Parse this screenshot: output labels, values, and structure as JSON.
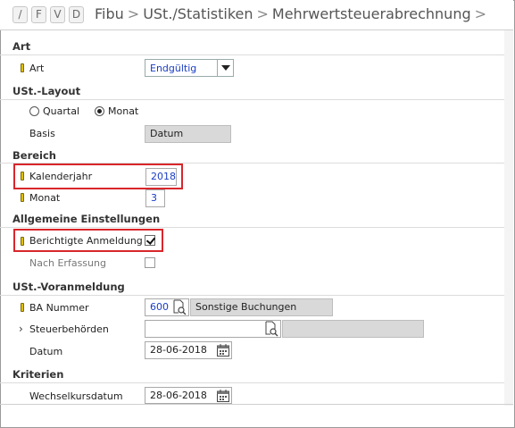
{
  "header": {
    "buttons": [
      "/",
      "F",
      "V",
      "D"
    ],
    "breadcrumb": [
      "Fibu",
      "USt./Statistiken",
      "Mehrwertsteuerabrechnung"
    ],
    "separator": ">"
  },
  "sections": {
    "art": "Art",
    "layout": "USt.-Layout",
    "bereich": "Bereich",
    "allgemein": "Allgemeine Einstellungen",
    "voranmeldung": "USt.-Voranmeldung",
    "kriterien": "Kriterien"
  },
  "fields": {
    "art": {
      "label": "Art",
      "value": "Endgültig"
    },
    "quartal": {
      "label": "Quartal",
      "selected": false
    },
    "monat_radio": {
      "label": "Monat",
      "selected": true
    },
    "basis": {
      "label": "Basis",
      "value": "Datum"
    },
    "kalenderjahr": {
      "label": "Kalenderjahr",
      "value": "2018"
    },
    "monat": {
      "label": "Monat",
      "value": "3"
    },
    "berichtigte": {
      "label": "Berichtigte Anmeldung",
      "checked": true
    },
    "nach_erfassung": {
      "label": "Nach Erfassung",
      "checked": false
    },
    "ba_nummer": {
      "label": "BA Nummer",
      "value": "600",
      "description": "Sonstige Buchungen"
    },
    "steuerbehoerden": {
      "label": "Steuerbehörden",
      "value": "",
      "description": ""
    },
    "datum": {
      "label": "Datum",
      "value": "28-06-2018"
    },
    "wechselkursdatum": {
      "label": "Wechselkursdatum",
      "value": "28-06-2018"
    }
  },
  "colors": {
    "highlight": "#d9262b",
    "value_blue": "#1a3cc4",
    "required_marker": "#e0c000"
  }
}
